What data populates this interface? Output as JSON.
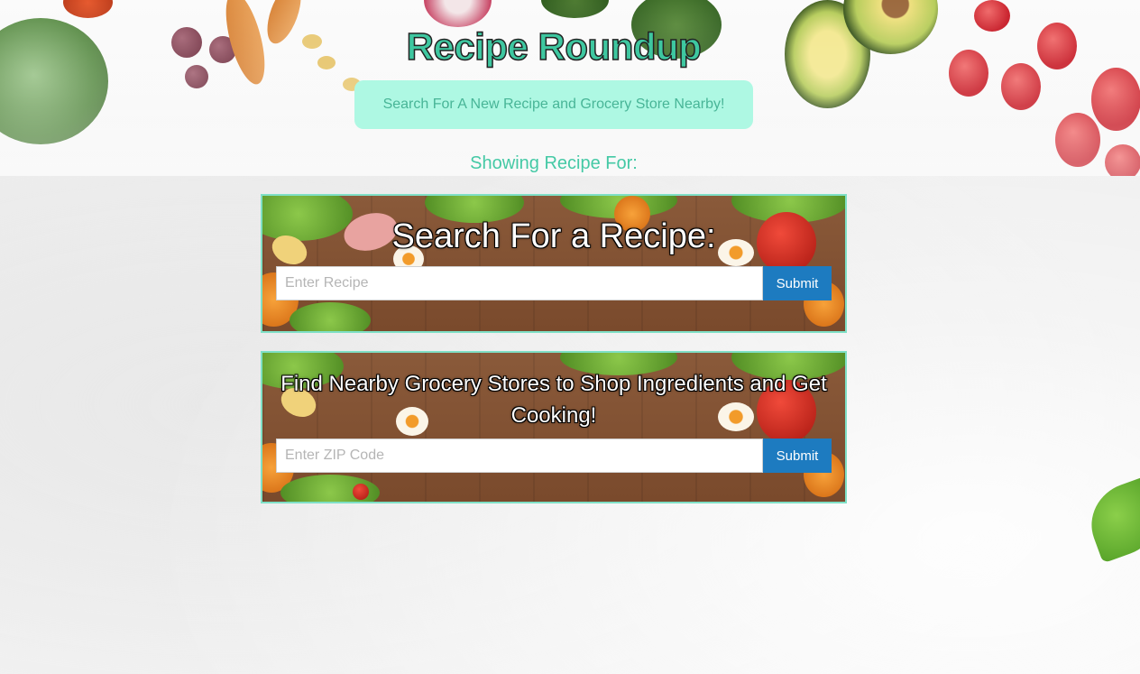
{
  "header": {
    "title": "Recipe Roundup",
    "tagline": "Search For A New Recipe and Grocery Store Nearby!",
    "showing_label": "Showing Recipe For:"
  },
  "recipe_search": {
    "heading": "Search For a Recipe:",
    "input_value": "",
    "placeholder": "Enter Recipe",
    "submit_label": "Submit"
  },
  "grocery_search": {
    "heading": "Find Nearby Grocery Stores to Shop Ingredients and Get Cooking!",
    "input_value": "",
    "placeholder": "Enter ZIP Code",
    "submit_label": "Submit"
  },
  "colors": {
    "title": "#3ec7a0",
    "tagline_bg": "#aef8e3",
    "tagline_text": "#48b597",
    "card_border": "#7fe0c6",
    "button": "#1d7bc0"
  }
}
